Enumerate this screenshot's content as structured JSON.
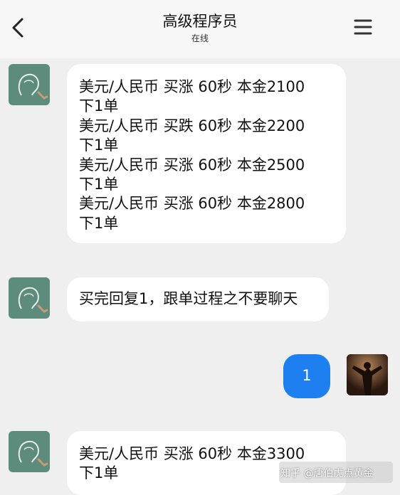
{
  "header": {
    "title": "高级程序员",
    "status": "在线"
  },
  "icons": {
    "back": "chevron-left-icon",
    "menu": "hamburger-menu-icon"
  },
  "messages": [
    {
      "sender": "contact",
      "lines": [
        "美元/人民币  买涨  60秒  本金2100",
        "下1单",
        "美元/人民币  买跌  60秒  本金2200",
        "下1单",
        "美元/人民币  买涨  60秒  本金2500",
        "下1单",
        "美元/人民币  买涨  60秒  本金2800",
        "下1单"
      ]
    },
    {
      "sender": "contact",
      "lines": [
        "买完回复1，跟单过程之不要聊天"
      ]
    },
    {
      "sender": "me",
      "lines": [
        "1"
      ]
    },
    {
      "sender": "contact",
      "lines": [
        "美元/人民币  买涨  60秒  本金3300",
        "下1单"
      ]
    }
  ],
  "watermark": "知乎 @唐伯虎点黄金",
  "colors": {
    "background": "#efefef",
    "bubble_contact": "#ffffff",
    "bubble_me": "#1e7ff0",
    "contact_avatar": "#5d8c7c"
  }
}
